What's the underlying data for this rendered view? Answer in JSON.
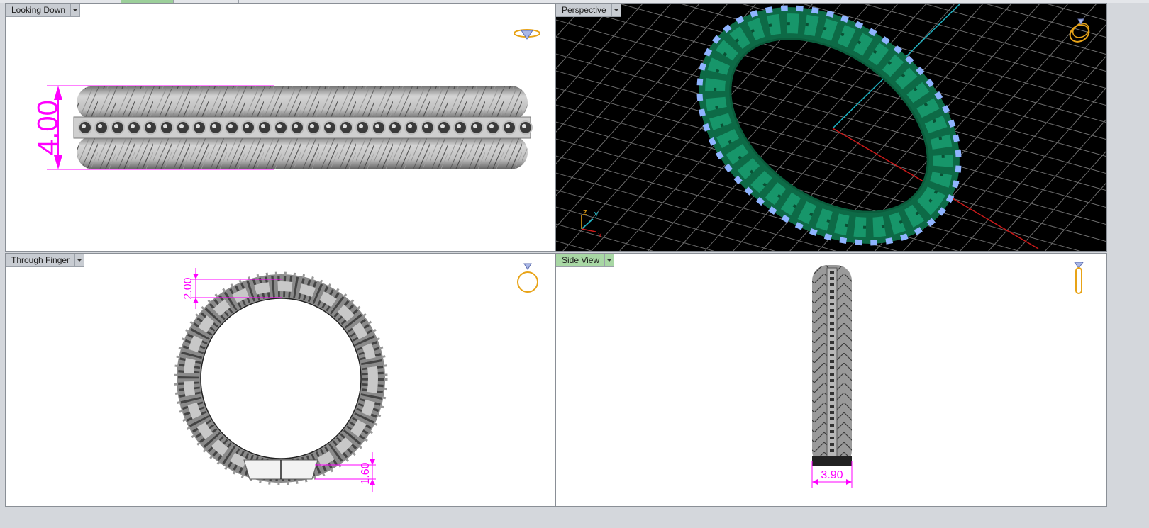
{
  "viewports": {
    "looking_down": {
      "label": "Looking Down",
      "dimension": "4.00"
    },
    "perspective": {
      "label": "Perspective",
      "axes": {
        "z": "z",
        "y": "y",
        "x": "x"
      }
    },
    "through_finger": {
      "label": "Through Finger",
      "dim_top": "2.00",
      "dim_bottom": "1.60"
    },
    "side_view": {
      "label": "Side View",
      "dimension": "3.90",
      "active": true
    }
  },
  "colors": {
    "dimension": "#ff00ff",
    "active_label": "#a8d7a4",
    "ring_green": "#0f7a52",
    "gem_blue": "#8fb4ff",
    "grid_line": "#6c6c6c",
    "axis_red": "#cc1a1a",
    "axis_cyan": "#1fb4c4"
  },
  "icons": {
    "view_nav": "ring-orientation-icon",
    "dropdown": "chevron-down-icon"
  }
}
